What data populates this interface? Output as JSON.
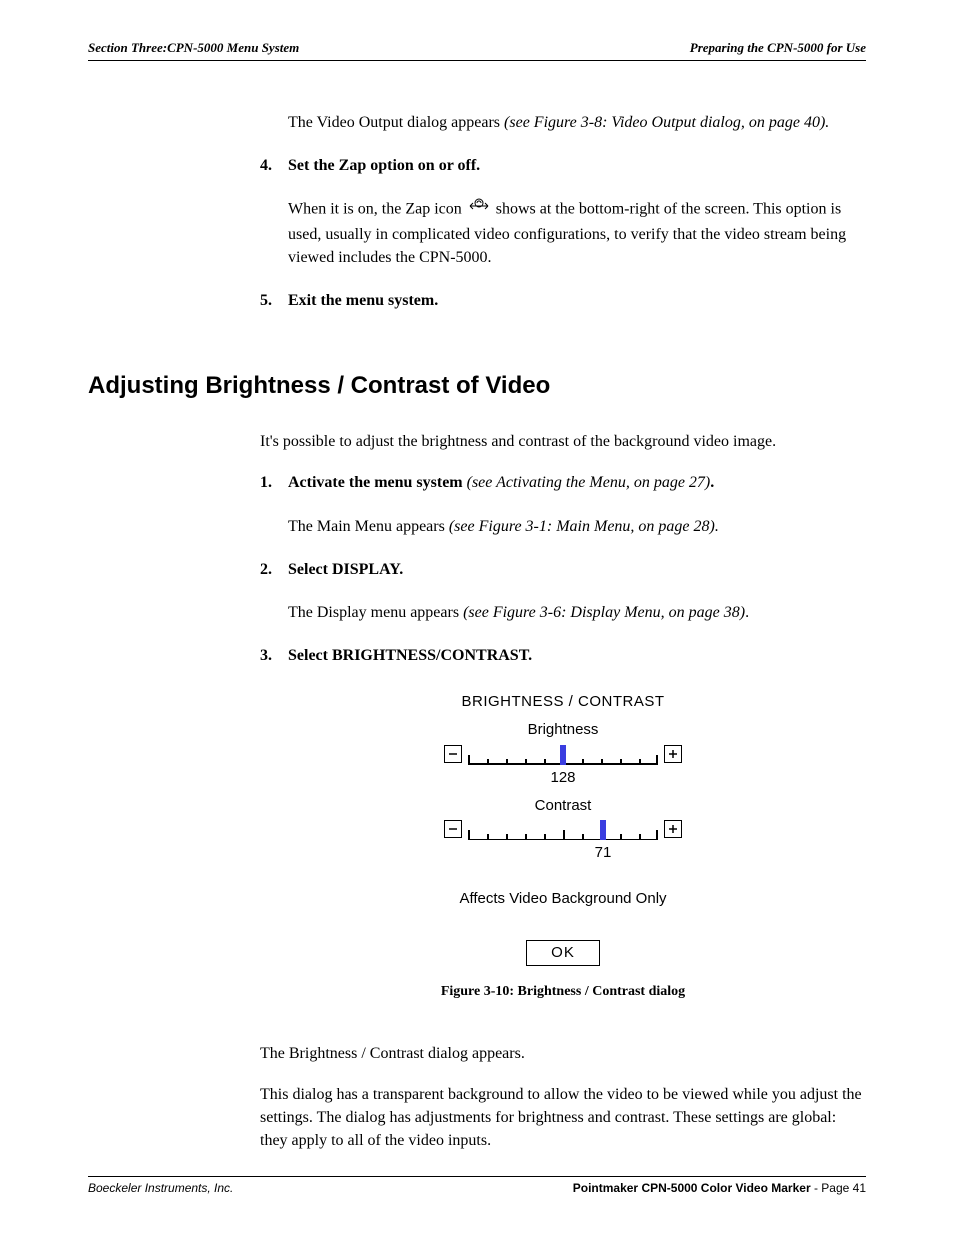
{
  "header": {
    "left": "Section Three:CPN-5000 Menu System",
    "right": "Preparing the CPN-5000 for Use"
  },
  "intro": {
    "videoOutputAppears_pre": "The Video Output dialog appears ",
    "videoOutputAppears_ref": "(see Figure 3-8: Video Output dialog, on page 40).",
    "step4_num": "4.",
    "step4_text": "Set the Zap option on or off.",
    "step4_body_pre": "When it is on, the Zap icon ",
    "step4_body_post": " shows at the bottom-right of the screen. This option is used, usually in complicated video configurations, to verify that the video stream being viewed includes the CPN-5000.",
    "step5_num": "5.",
    "step5_text": "Exit the menu system."
  },
  "section_title": "Adjusting Brightness / Contrast of Video",
  "adjust": {
    "intro": "It's possible to adjust the brightness and contrast of the background video image.",
    "step1_num": "1.",
    "step1_text": "Activate the menu system ",
    "step1_ref": "(see Activating the Menu, on page 27)",
    "step1_period": ".",
    "step1_body_pre": "The Main Menu appears ",
    "step1_body_ref": "(see Figure 3-1: Main Menu, on page 28).",
    "step2_num": "2.",
    "step2_text": "Select DISPLAY.",
    "step2_body_pre": "The Display menu appears ",
    "step2_body_ref": "(see Figure 3-6: Display Menu, on page 38)",
    "step2_body_period": ".",
    "step3_num": "3.",
    "step3_text": "Select BRIGHTNESS/CONTRAST."
  },
  "dialog": {
    "title": "BRIGHTNESS / CONTRAST",
    "brightness_label": "Brightness",
    "brightness_value": "128",
    "contrast_label": "Contrast",
    "contrast_value": "71",
    "note": "Affects Video Background Only",
    "ok": "OK"
  },
  "caption": "Figure 3-10:  Brightness / Contrast dialog",
  "closing": {
    "p1": "The Brightness / Contrast dialog appears.",
    "p2": "This dialog has a transparent background to allow the video to be viewed while you adjust the settings. The dialog has adjustments for brightness and contrast. These settings are global: they apply to all of the video inputs."
  },
  "footer": {
    "left": "Boeckeler Instruments, Inc.",
    "right_bold": "Pointmaker CPN-5000 Color Video Marker",
    "right_rest": " - Page 41"
  }
}
